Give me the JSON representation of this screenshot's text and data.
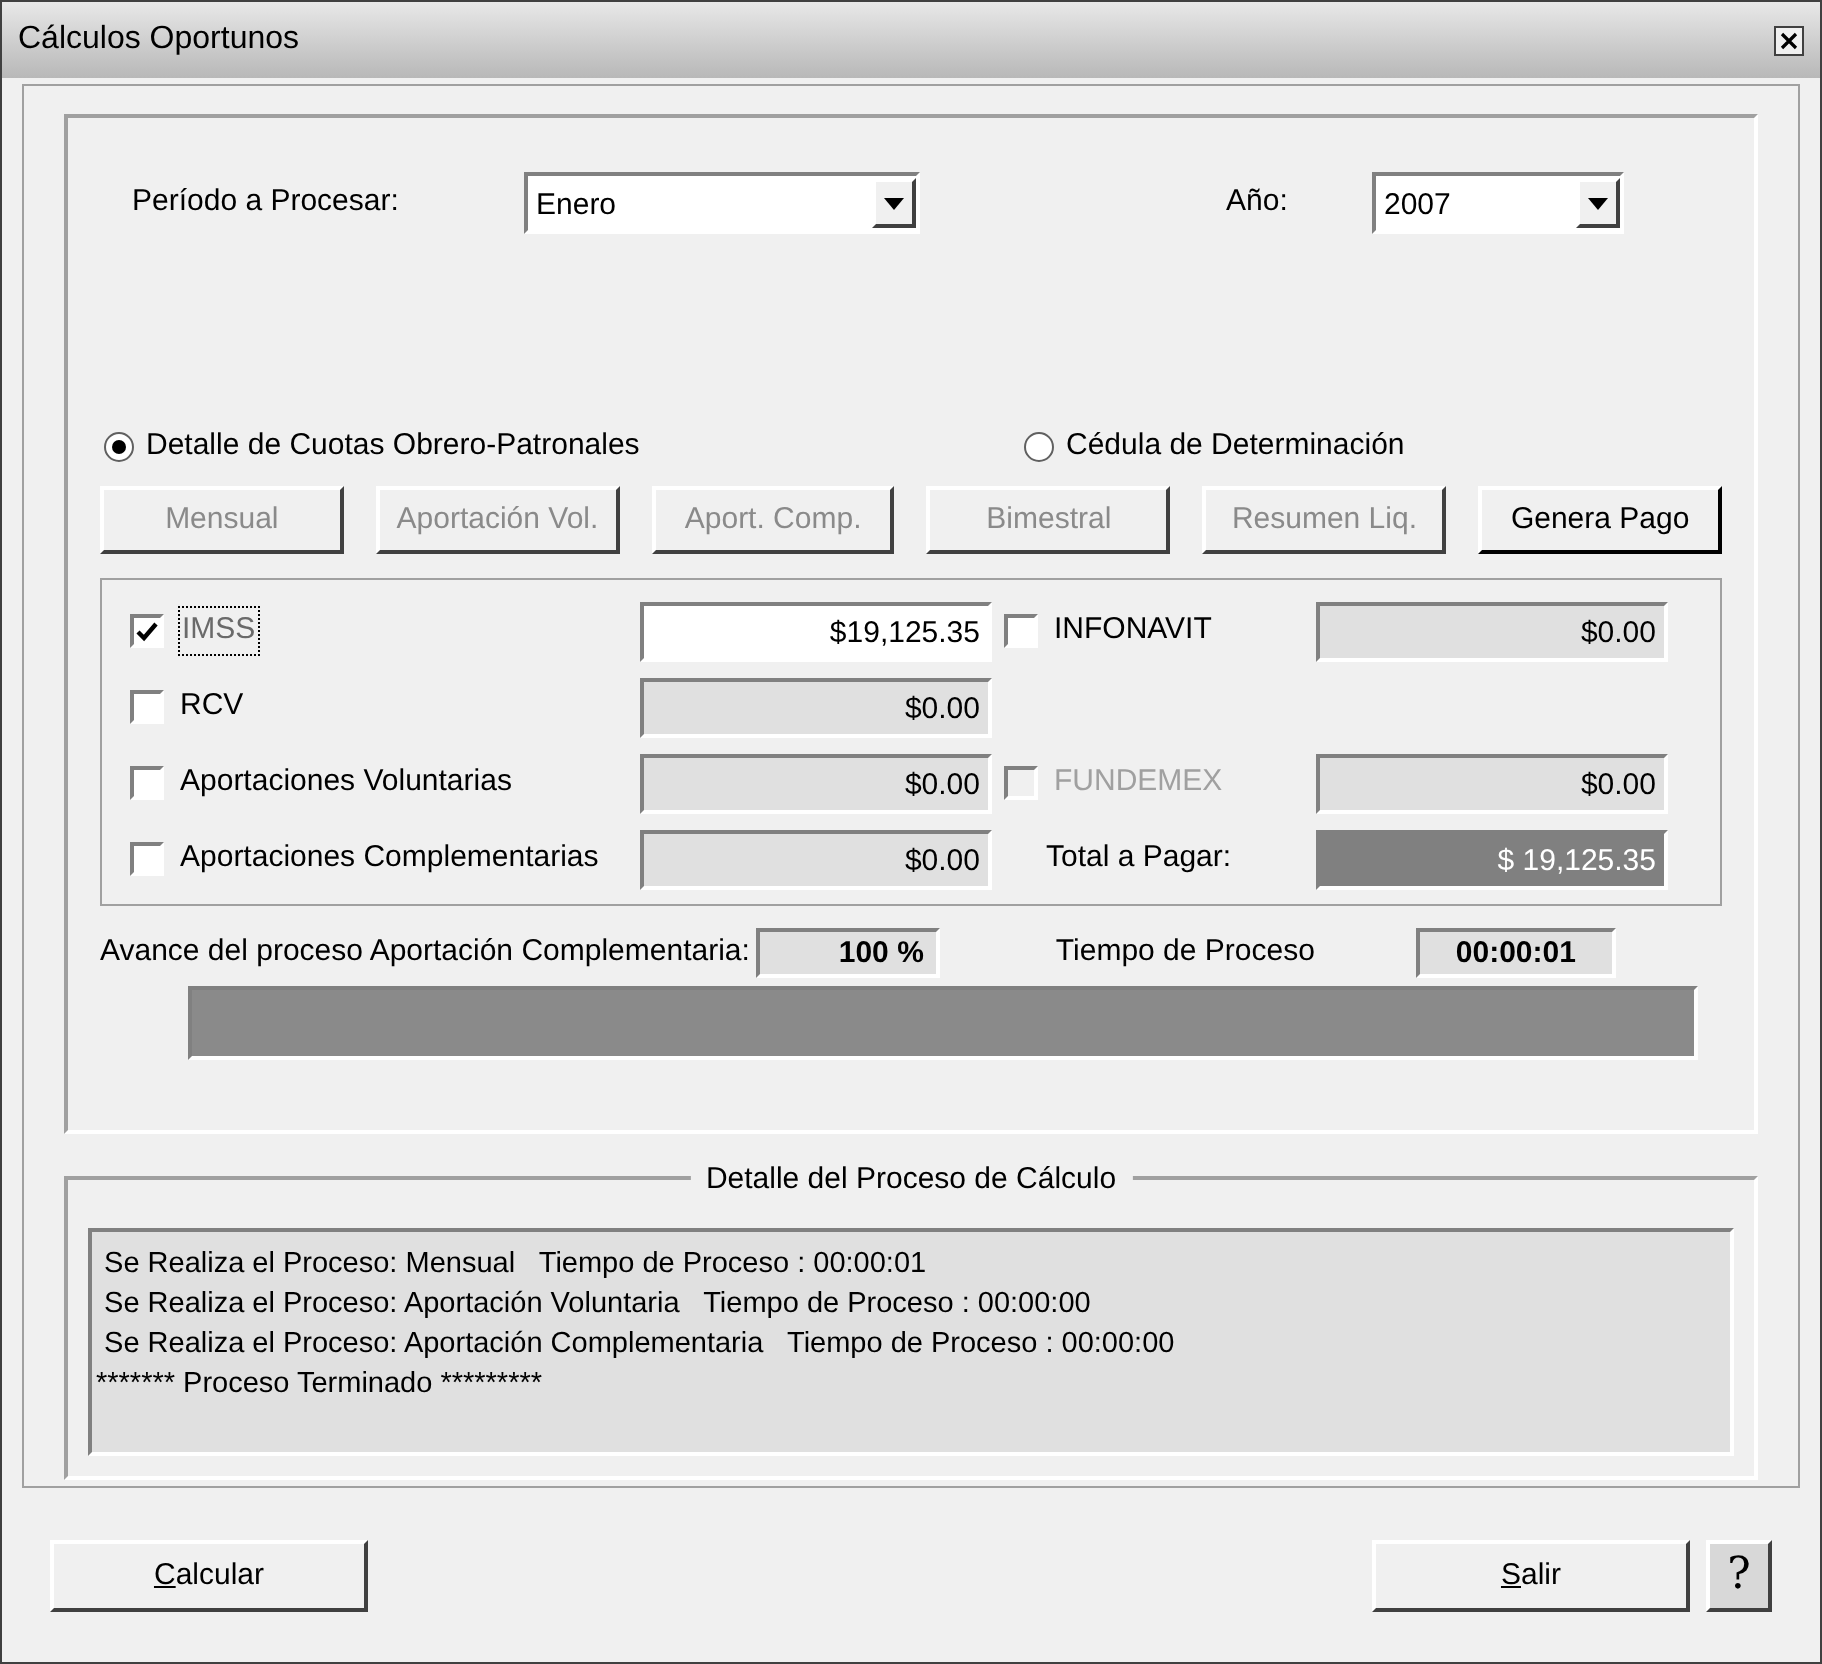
{
  "window": {
    "title": "Cálculos Oportunos"
  },
  "period": {
    "label": "Período a Procesar:",
    "value": "Enero"
  },
  "year": {
    "label": "Año:",
    "value": "2007"
  },
  "report_options": [
    {
      "label": "Detalle de Cuotas Obrero-Patronales",
      "selected": true
    },
    {
      "label": "Cédula de Determinación",
      "selected": false
    }
  ],
  "process_buttons": [
    {
      "label": "Mensual",
      "disabled": true
    },
    {
      "label": "Aportación Vol.",
      "disabled": true
    },
    {
      "label": "Aport. Comp.",
      "disabled": true
    },
    {
      "label": "Bimestral",
      "disabled": true
    },
    {
      "label": "Resumen Liq.",
      "disabled": true
    },
    {
      "label": "Genera Pago",
      "disabled": false
    }
  ],
  "left_items": [
    {
      "label": "IMSS",
      "checked": true,
      "focused": true,
      "value": "$19,125.35",
      "editable": true
    },
    {
      "label": "RCV",
      "checked": false,
      "focused": false,
      "value": "$0.00",
      "editable": false
    },
    {
      "label": "Aportaciones Voluntarias",
      "checked": false,
      "focused": false,
      "value": "$0.00",
      "editable": false
    },
    {
      "label": "Aportaciones Complementarias",
      "checked": false,
      "focused": false,
      "value": "$0.00",
      "editable": false
    }
  ],
  "right_items": [
    {
      "kind": "checkbox",
      "label": "INFONAVIT",
      "checked": false,
      "disabled": false,
      "value": "$0.00"
    },
    {
      "kind": "empty"
    },
    {
      "kind": "checkbox",
      "label": "FUNDEMEX",
      "checked": false,
      "disabled": true,
      "value": "$0.00"
    },
    {
      "kind": "total",
      "label": "Total a Pagar:",
      "value": "$ 19,125.35"
    }
  ],
  "progress": {
    "label": "Avance del proceso Aportación Complementaria:",
    "percent": "100 %",
    "time_label": "Tiempo de Proceso",
    "time": "00:00:01",
    "level": 1
  },
  "log": {
    "title": "Detalle del Proceso de Cálculo",
    "lines": [
      " Se Realiza el Proceso: Mensual   Tiempo de Proceso : 00:00:01",
      " Se Realiza el Proceso: Aportación Voluntaria   Tiempo de Proceso : 00:00:00",
      " Se Realiza el Proceso: Aportación Complementaria   Tiempo de Proceso : 00:00:00",
      "******* Proceso Terminado *********"
    ]
  },
  "footer_buttons": [
    {
      "kind": "text",
      "label": "Calcular",
      "mnemonic": true
    },
    {
      "kind": "text",
      "label": "Salir",
      "mnemonic": true
    },
    {
      "kind": "help",
      "label": "?"
    }
  ]
}
